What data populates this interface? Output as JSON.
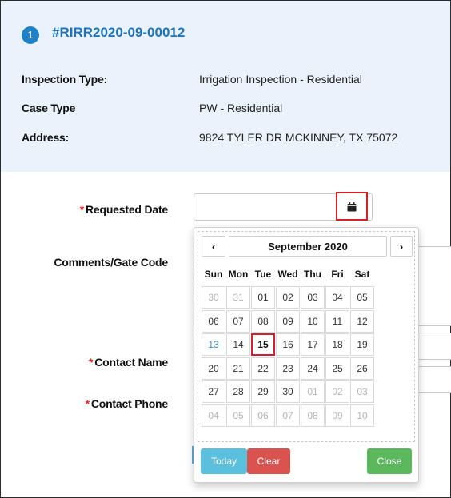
{
  "header": {
    "step_number": "1",
    "case_id": "#RIRR2020-09-00012",
    "rows": [
      {
        "label": "Inspection Type:",
        "value": "Irrigation Inspection - Residential"
      },
      {
        "label": "Case Type",
        "value": "PW - Residential"
      },
      {
        "label": "Address:",
        "value": "9824 TYLER DR MCKINNEY, TX 75072"
      }
    ]
  },
  "form": {
    "required_marker": "*",
    "requested_date_label": "Requested Date",
    "requested_date_value": "",
    "comments_label": "Comments/Gate Code",
    "contact_name_label": "Contact Name",
    "contact_phone_label": "Contact Phone"
  },
  "datepicker": {
    "prev_glyph": "‹",
    "next_glyph": "›",
    "month_label": "September 2020",
    "weekdays": [
      "Sun",
      "Mon",
      "Tue",
      "Wed",
      "Thu",
      "Fri",
      "Sat"
    ],
    "weeks": [
      [
        "30",
        "31",
        "01",
        "02",
        "03",
        "04",
        "05"
      ],
      [
        "06",
        "07",
        "08",
        "09",
        "10",
        "11",
        "12"
      ],
      [
        "13",
        "14",
        "15",
        "16",
        "17",
        "18",
        "19"
      ],
      [
        "20",
        "21",
        "22",
        "23",
        "24",
        "25",
        "26"
      ],
      [
        "27",
        "28",
        "29",
        "30",
        "01",
        "02",
        "03"
      ],
      [
        "04",
        "05",
        "06",
        "07",
        "08",
        "09",
        "10"
      ]
    ],
    "today_label": "Today",
    "clear_label": "Clear",
    "close_label": "Close",
    "colors": {
      "today_btn": "#5bc0de",
      "clear_btn": "#d9534f",
      "close_btn": "#5cb85c",
      "highlight": "#d61f2b"
    }
  }
}
